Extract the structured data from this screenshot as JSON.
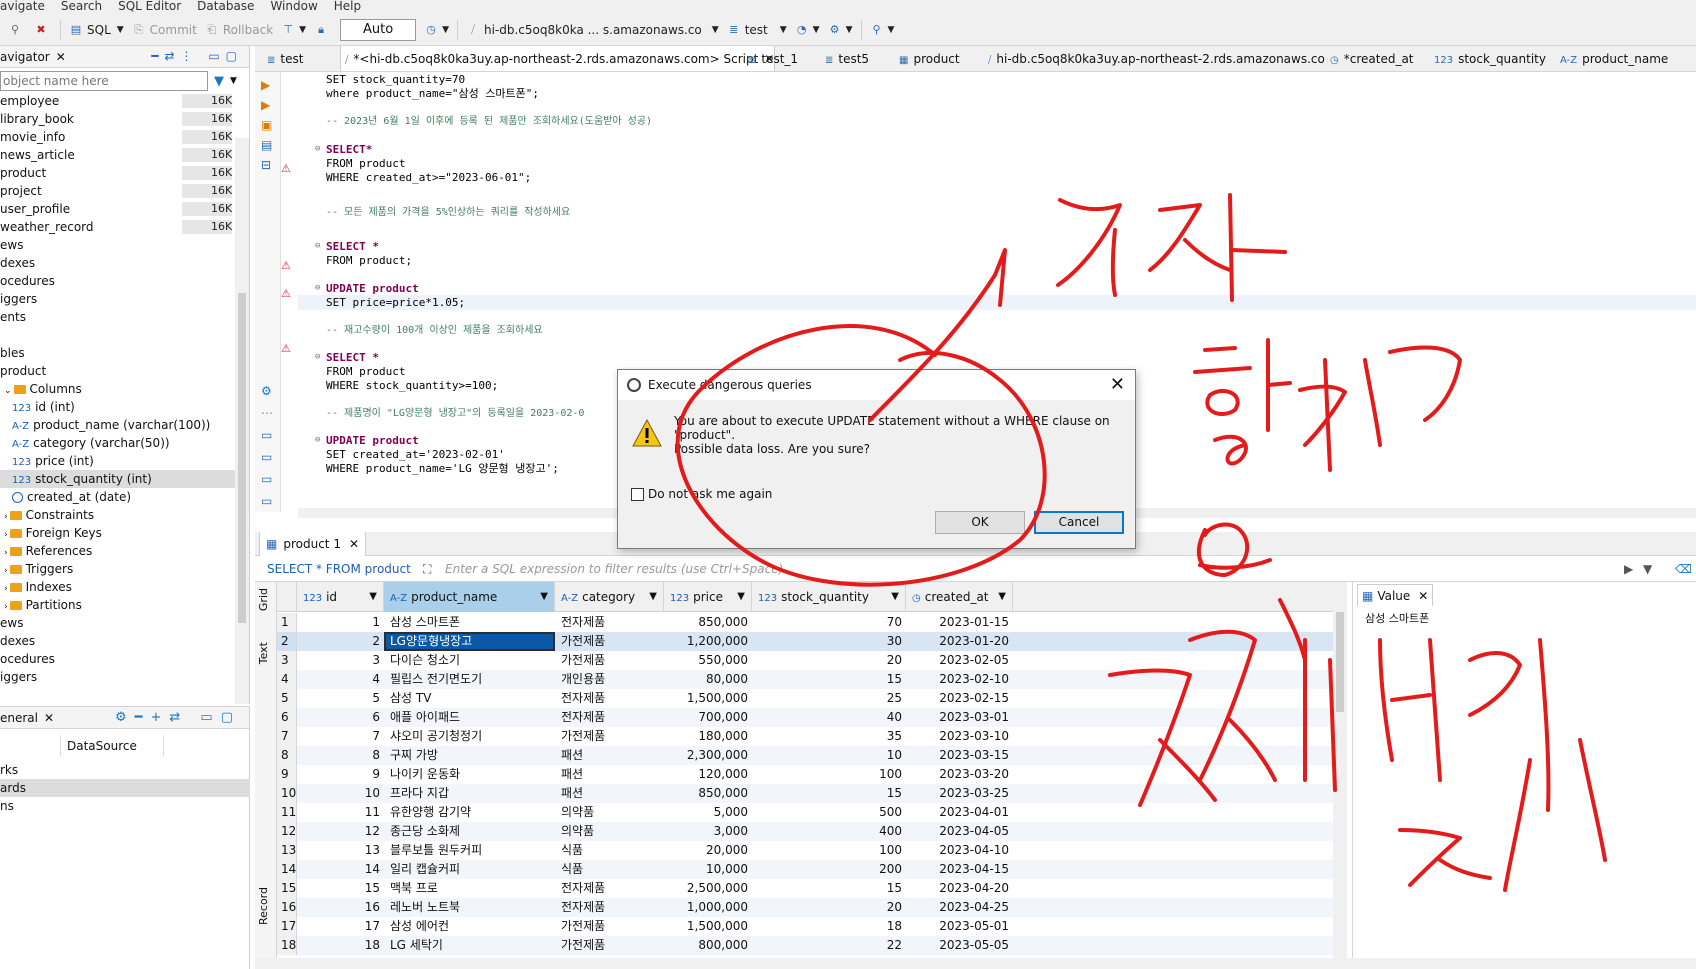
{
  "menu": [
    "avigate",
    "Search",
    "SQL Editor",
    "Database",
    "Window",
    "Help"
  ],
  "toolbar": {
    "sql": "SQL",
    "commit": "Commit",
    "rollback": "Rollback",
    "auto": "Auto",
    "connection": "hi-db.c5oq8k0ka ... s.amazonaws.co",
    "schema": "test"
  },
  "navigator": {
    "title": "avigator",
    "filter_placeholder": "object name here",
    "tables": [
      {
        "name": "employee",
        "size": "16K"
      },
      {
        "name": "library_book",
        "size": "16K"
      },
      {
        "name": "movie_info",
        "size": "16K"
      },
      {
        "name": "news_article",
        "size": "16K"
      },
      {
        "name": "product",
        "size": "16K"
      },
      {
        "name": "project",
        "size": "16K"
      },
      {
        "name": "user_profile",
        "size": "16K"
      },
      {
        "name": "weather_record",
        "size": "16K"
      }
    ],
    "folders1": [
      "ews",
      "dexes",
      "ocedures",
      "iggers",
      "ents"
    ],
    "tables_label": "bles",
    "product_label": "product",
    "columns_label": "Columns",
    "columns": [
      {
        "type": "123",
        "label": "id (int)"
      },
      {
        "type": "A-Z",
        "label": "product_name (varchar(100))"
      },
      {
        "type": "A-Z",
        "label": "category (varchar(50))"
      },
      {
        "type": "123",
        "label": "price (int)"
      },
      {
        "type": "123",
        "label": "stock_quantity (int)"
      },
      {
        "type": "clock",
        "label": "created_at (date)"
      }
    ],
    "subfolders": [
      "Constraints",
      "Foreign Keys",
      "References",
      "Triggers",
      "Indexes",
      "Partitions"
    ],
    "folders2": [
      "ews",
      "dexes",
      "ocedures",
      "iggers"
    ]
  },
  "general": {
    "title": "eneral",
    "tab": "DataSource",
    "rows": [
      "rks",
      "ards",
      "ns"
    ]
  },
  "editor_tabs": [
    "test",
    "*<hi-db.c5oq8k0ka3uy.ap-northeast-2.rds.amazonaws.com> Script",
    "test_1",
    "test5",
    "product",
    "hi-db.c5oq8k0ka3uy.ap-northeast-2.rds.amazonaws.co",
    "*created_at",
    "stock_quantity",
    "product_name"
  ],
  "code": [
    "SET stock_quantity=70",
    "where product_name=\"삼성 스마트폰\";",
    "-- 2023년 6월 1일 이후에 등록 된 제품만 조회하세요(도움받아 성공)",
    "SELECT*",
    "FROM product",
    "WHERE created_at>=\"2023-06-01\";",
    "-- 모든 제품의 가격을 5%인상하는 쿼리를 작성하세요",
    "SELECT *",
    "FROM product;",
    "UPDATE product",
    "SET price=price*1.05;",
    "-- 재고수량이 100개 이상인 제품을 조회하세요",
    "SELECT *",
    "FROM product",
    "WHERE stock_quantity>=100;",
    "-- 제품명이 \"LG양문형 냉장고\"의 등록일을 2023-02-0",
    "UPDATE product",
    "SET created_at='2023-02-01'",
    "WHERE product_name='LG 양문형 냉장고';"
  ],
  "results": {
    "tab": "product 1",
    "query": "SELECT * FROM product",
    "filter_placeholder": "Enter a SQL expression to filter results (use Ctrl+Space)",
    "side_labels": [
      "Grid",
      "Text",
      "Record"
    ],
    "columns": [
      "id",
      "product_name",
      "category",
      "price",
      "stock_quantity",
      "created_at"
    ],
    "rows": [
      [
        "1",
        "1",
        "삼성 스마트폰",
        "전자제품",
        "850,000",
        "70",
        "2023-01-15"
      ],
      [
        "2",
        "2",
        "LG양문형냉장고",
        "가전제품",
        "1,200,000",
        "30",
        "2023-01-20"
      ],
      [
        "3",
        "3",
        "다이슨 청소기",
        "가전제품",
        "550,000",
        "20",
        "2023-02-05"
      ],
      [
        "4",
        "4",
        "필립스 전기면도기",
        "개인용품",
        "80,000",
        "15",
        "2023-02-10"
      ],
      [
        "5",
        "5",
        "삼성 TV",
        "전자제품",
        "1,500,000",
        "25",
        "2023-02-15"
      ],
      [
        "6",
        "6",
        "애플 아이패드",
        "전자제품",
        "700,000",
        "40",
        "2023-03-01"
      ],
      [
        "7",
        "7",
        "샤오미 공기청정기",
        "가전제품",
        "180,000",
        "35",
        "2023-03-10"
      ],
      [
        "8",
        "8",
        "구찌 가방",
        "패션",
        "2,300,000",
        "10",
        "2023-03-15"
      ],
      [
        "9",
        "9",
        "나이키 운동화",
        "패션",
        "120,000",
        "100",
        "2023-03-20"
      ],
      [
        "10",
        "10",
        "프라다 지갑",
        "패션",
        "850,000",
        "15",
        "2023-03-25"
      ],
      [
        "11",
        "11",
        "유한양행 감기약",
        "의약품",
        "5,000",
        "500",
        "2023-04-01"
      ],
      [
        "12",
        "12",
        "종근당 소화제",
        "의약품",
        "3,000",
        "400",
        "2023-04-05"
      ],
      [
        "13",
        "13",
        "블루보틀 원두커피",
        "식품",
        "20,000",
        "100",
        "2023-04-10"
      ],
      [
        "14",
        "14",
        "일리 캡슐커피",
        "식품",
        "10,000",
        "200",
        "2023-04-15"
      ],
      [
        "15",
        "15",
        "맥북 프로",
        "전자제품",
        "2,500,000",
        "15",
        "2023-04-20"
      ],
      [
        "16",
        "16",
        "레노버 노트북",
        "전자제품",
        "1,000,000",
        "20",
        "2023-04-25"
      ],
      [
        "17",
        "17",
        "삼성 에어컨",
        "가전제품",
        "1,500,000",
        "18",
        "2023-05-01"
      ],
      [
        "18",
        "18",
        "LG 세탁기",
        "가전제품",
        "800,000",
        "22",
        "2023-05-05"
      ]
    ]
  },
  "value_panel": {
    "title": "Value",
    "text": "삼성 스마트폰"
  },
  "dialog": {
    "title": "Execute dangerous queries",
    "message_lines": [
      "You are about to execute UPDATE statement without a WHERE clause on",
      "\"product\".",
      "Possible data loss. Are you sure?"
    ],
    "checkbox": "Do not ask me again",
    "ok": "OK",
    "cancel": "Cancel"
  },
  "colors": {
    "annotation": "#e31b1b",
    "selection": "#0a58a8"
  }
}
